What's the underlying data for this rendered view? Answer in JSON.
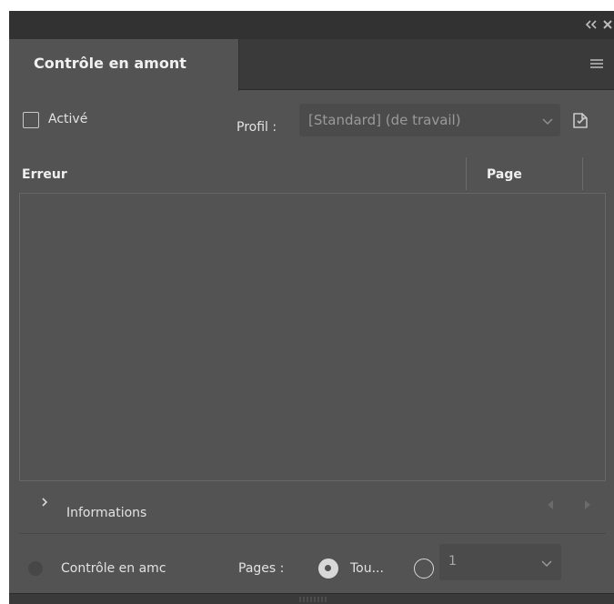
{
  "panel": {
    "tab_title": "Contrôle en amont",
    "active_label": "Activé",
    "profile_label": "Profil :",
    "profile_value": "[Standard] (de travail)",
    "icons": [
      "collapse-icon",
      "close-icon",
      "menu-icon",
      "profiles-icon",
      "chevron-down-icon",
      "chevron-right-icon",
      "previous-icon",
      "next-icon"
    ],
    "list": {
      "error_header": "Erreur",
      "page_header": "Page"
    },
    "details_label": "Informations",
    "status_label": "Contrôle en amc",
    "pages_label": "Pages :",
    "all_label": "Tou...",
    "range_value": "1",
    "colors": {
      "panel_bg": "#535353",
      "title_bar": "#323232",
      "tab_bar": "#3a3a3a",
      "input_bg": "#4b4b4b"
    }
  }
}
